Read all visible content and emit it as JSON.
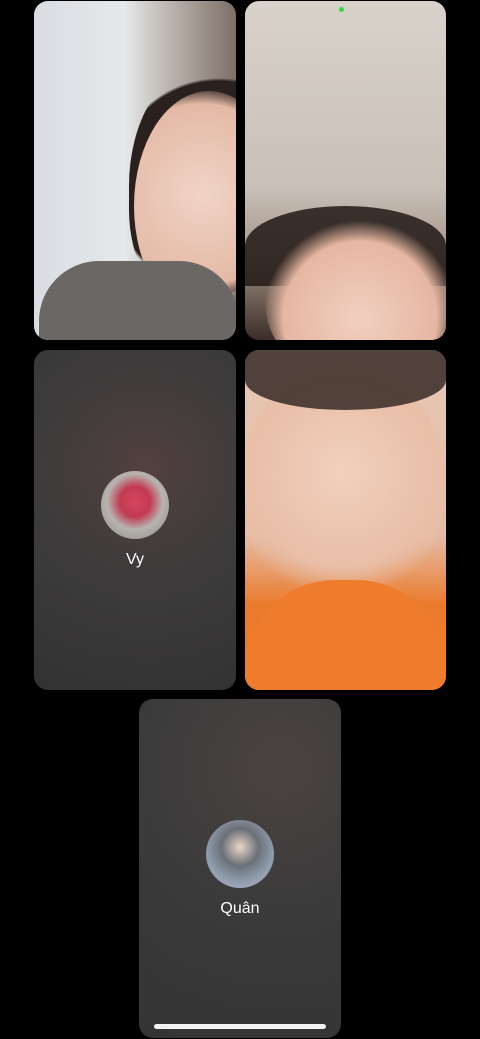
{
  "participants": [
    {
      "id": "p1",
      "type": "video"
    },
    {
      "id": "p2",
      "type": "video",
      "indicator_color": "#39d84a"
    },
    {
      "id": "p3",
      "type": "avatar",
      "name": "Vy"
    },
    {
      "id": "p4",
      "type": "video"
    },
    {
      "id": "p5",
      "type": "avatar",
      "name": "Quân"
    }
  ],
  "colors": {
    "background": "#000000",
    "name_text": "#ffffff",
    "home_indicator": "#f2f2f2"
  }
}
